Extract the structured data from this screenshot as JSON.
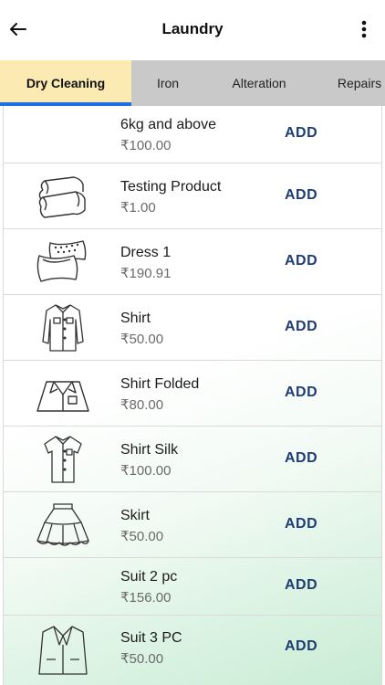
{
  "header": {
    "title": "Laundry",
    "back_icon": "arrow-left-icon",
    "menu_icon": "more-vertical-icon"
  },
  "tabs": [
    {
      "label": "Dry Cleaning",
      "active": true
    },
    {
      "label": "Iron",
      "active": false
    },
    {
      "label": "Alteration",
      "active": false
    },
    {
      "label": "Repairs",
      "active": false
    }
  ],
  "colors": {
    "active_tab_bg": "#fbeab1",
    "active_tab_indicator": "#1f6fe5",
    "tab_bar_bg": "#c9c9c9",
    "add_button": "#1f3d73"
  },
  "items": [
    {
      "name": "6kg and above",
      "price": "₹100.00",
      "add_label": "ADD",
      "icon": ""
    },
    {
      "name": "Testing Product",
      "price": "₹1.00",
      "add_label": "ADD",
      "icon": "folded-towels-icon"
    },
    {
      "name": "Dress 1",
      "price": "₹190.91",
      "add_label": "ADD",
      "icon": "pillows-icon"
    },
    {
      "name": "Shirt",
      "price": "₹50.00",
      "add_label": "ADD",
      "icon": "long-sleeve-shirt-icon"
    },
    {
      "name": "Shirt Folded",
      "price": "₹80.00",
      "add_label": "ADD",
      "icon": "folded-shirt-icon"
    },
    {
      "name": "Shirt Silk",
      "price": "₹100.00",
      "add_label": "ADD",
      "icon": "short-sleeve-shirt-icon"
    },
    {
      "name": "Skirt",
      "price": "₹50.00",
      "add_label": "ADD",
      "icon": "skirt-icon"
    },
    {
      "name": "Suit 2 pc",
      "price": "₹156.00",
      "add_label": "ADD",
      "icon": ""
    },
    {
      "name": "Suit 3 PC",
      "price": "₹50.00",
      "add_label": "ADD",
      "icon": "suit-jacket-icon"
    }
  ]
}
